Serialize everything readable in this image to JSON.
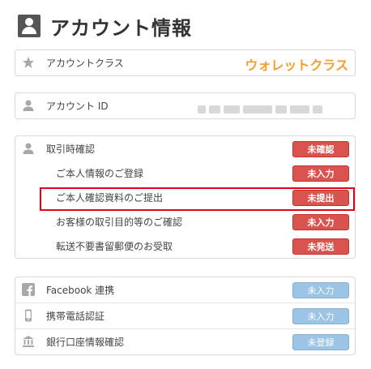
{
  "header": {
    "title": "アカウント情報",
    "icon": "user-square-icon"
  },
  "account_class": {
    "label": "アカウントクラス",
    "value": "ウォレットクラス",
    "icon": "star-icon"
  },
  "account_id": {
    "label": "アカウント ID",
    "icon": "person-icon"
  },
  "verification": {
    "label": "取引時確認",
    "status": "未確認",
    "icon": "person-icon",
    "items": [
      {
        "label": "ご本人情報のご登録",
        "status": "未入力"
      },
      {
        "label": "ご本人確認資料のご提出",
        "status": "未提出"
      },
      {
        "label": "お客様の取引目的等のご確認",
        "status": "未入力"
      },
      {
        "label": "転送不要書留郵便のお受取",
        "status": "未発送"
      }
    ]
  },
  "links": [
    {
      "label": "Facebook 連携",
      "status": "未入力",
      "icon": "facebook-icon"
    },
    {
      "label": "携帯電話認証",
      "status": "未入力",
      "icon": "mobile-phone-icon"
    },
    {
      "label": "銀行口座情報確認",
      "status": "未登録",
      "icon": "bank-icon"
    }
  ],
  "colors": {
    "red_button": "#d9534f",
    "blue_button": "#9cc4e4",
    "wallet_text": "#f0a030",
    "highlight": "#e2001a"
  }
}
